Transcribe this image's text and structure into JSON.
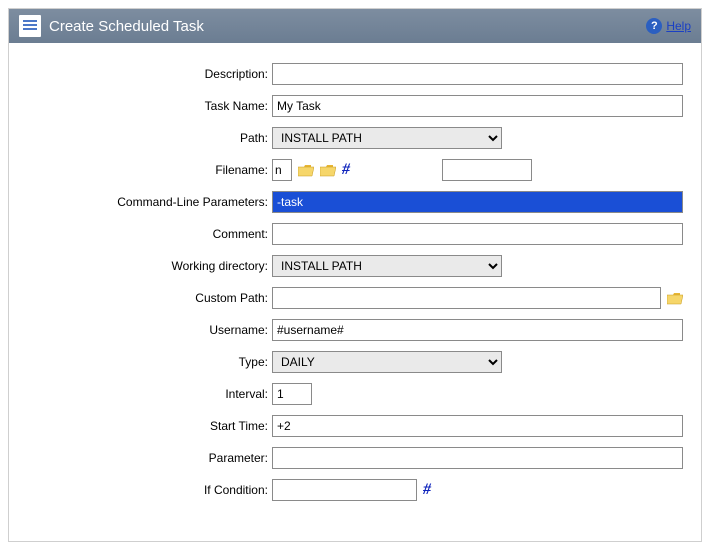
{
  "header": {
    "title": "Create Scheduled Task",
    "help_label": "Help"
  },
  "labels": {
    "description": "Description:",
    "task_name": "Task Name:",
    "path": "Path:",
    "filename": "Filename:",
    "cmd_params": "Command-Line Parameters:",
    "comment": "Comment:",
    "working_dir": "Working directory:",
    "custom_path": "Custom Path:",
    "username": "Username:",
    "type": "Type:",
    "interval": "Interval:",
    "start_time": "Start Time:",
    "parameter": "Parameter:",
    "if_condition": "If Condition:"
  },
  "values": {
    "description": "",
    "task_name": "My Task",
    "path": "INSTALL PATH",
    "filename": "n",
    "cmd_params": "-task",
    "comment": "",
    "working_dir": "INSTALL PATH",
    "custom_path": "",
    "username": "#username#",
    "type": "DAILY",
    "interval": "1",
    "start_time": "+2",
    "parameter": "",
    "if_condition": ""
  },
  "icons": {
    "hash": "#"
  },
  "options": {
    "path": [
      "INSTALL PATH"
    ],
    "working_dir": [
      "INSTALL PATH"
    ],
    "type": [
      "DAILY"
    ]
  }
}
